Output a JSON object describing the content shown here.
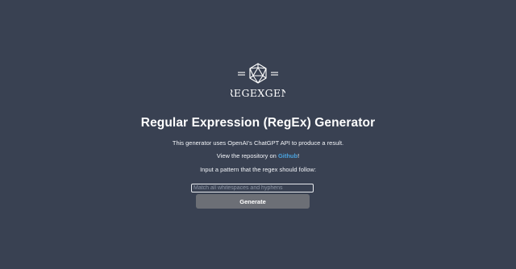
{
  "header": {
    "logo_text": "REGEXGEN",
    "logo_icon": "icosahedron-icon"
  },
  "main": {
    "title": "Regular Expression (RegEx) Generator",
    "description": "This generator uses OpenAI's ChatGPT API to produce a result.",
    "repo_prefix": "View the repository on ",
    "repo_link": "Github",
    "repo_suffix": "!",
    "prompt_label": "Input a pattern that the regex should follow:",
    "input_placeholder": "Match all whitespaces and hyphens",
    "input_value": "",
    "generate_label": "Generate"
  },
  "colors": {
    "background": "#394152",
    "link": "#4aa3df",
    "button": "#6c6f76",
    "text": "#ffffff"
  }
}
